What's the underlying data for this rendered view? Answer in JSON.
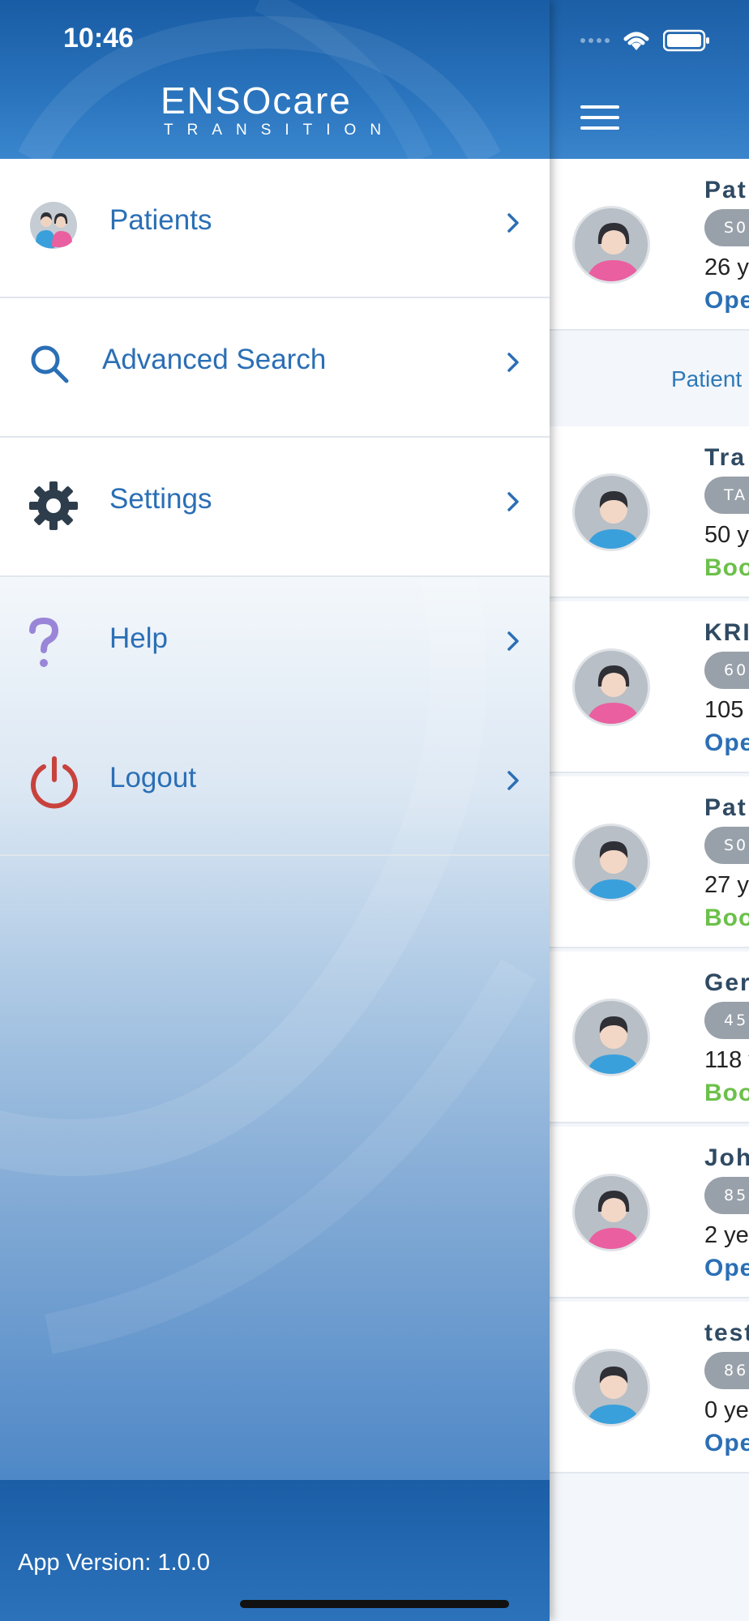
{
  "status_bar": {
    "time": "10:46"
  },
  "drawer": {
    "logo": {
      "brand": "ENSOcare",
      "tagline": "TRANSITION"
    },
    "items": [
      {
        "label": "Patients",
        "icon": "patients-icon"
      },
      {
        "label": "Advanced Search",
        "icon": "search-icon"
      },
      {
        "label": "Settings",
        "icon": "gear-icon"
      },
      {
        "label": "Help",
        "icon": "help-icon"
      },
      {
        "label": "Logout",
        "icon": "power-icon"
      }
    ],
    "footer": {
      "app_version": "App Version: 1.0.0"
    }
  },
  "main": {
    "section_label": "Patient",
    "cards": [
      {
        "name": "Pat",
        "badge": "S0",
        "age": "26 y",
        "status": "Ope",
        "status_color": "#2b6fb5",
        "gender": "female"
      },
      {
        "name": "Tra",
        "badge": "TA",
        "age": "50 y",
        "status": "Boo",
        "status_color": "#6cc04a",
        "gender": "male"
      },
      {
        "name": "KRI",
        "badge": "60",
        "age": "105",
        "status": "Ope",
        "status_color": "#2b6fb5",
        "gender": "female"
      },
      {
        "name": "Pat",
        "badge": "S0",
        "age": "27 y",
        "status": "Boo",
        "status_color": "#6cc04a",
        "gender": "male"
      },
      {
        "name": "Ger",
        "badge": "45",
        "age": "118 y",
        "status": "Boo",
        "status_color": "#6cc04a",
        "gender": "male"
      },
      {
        "name": "Joh",
        "badge": "85",
        "age": "2 ye",
        "status": "Ope",
        "status_color": "#2b6fb5",
        "gender": "female"
      },
      {
        "name": "test",
        "badge": "86",
        "age": "0 ye",
        "status": "Ope",
        "status_color": "#2b6fb5",
        "gender": "male"
      }
    ]
  },
  "colors": {
    "brand_blue": "#2a73bd",
    "open_blue": "#2b6fb5",
    "booked_green": "#6cc04a",
    "logout_red": "#c8423d",
    "help_purple": "#9a86d8"
  }
}
